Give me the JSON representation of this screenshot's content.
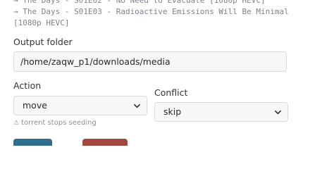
{
  "file_list": [
    "→ The Days - S01E02 - No Need to Evacuate [1080p HEVC]",
    "→ The Days - S01E03 - Radioactive Emissions Will Be Minimal [1080p HEVC]"
  ],
  "output_folder": {
    "label": "Output folder",
    "value": "/home/zaqw_p1/downloads/media"
  },
  "action": {
    "label": "Action",
    "selected": "move",
    "hint": "torrent stops seeding",
    "hint_icon": "warning-icon"
  },
  "conflict": {
    "label": "Conflict",
    "selected": "skip"
  },
  "colors": {
    "primary_button": "#2f6f8f",
    "danger_button": "#a4473f"
  }
}
